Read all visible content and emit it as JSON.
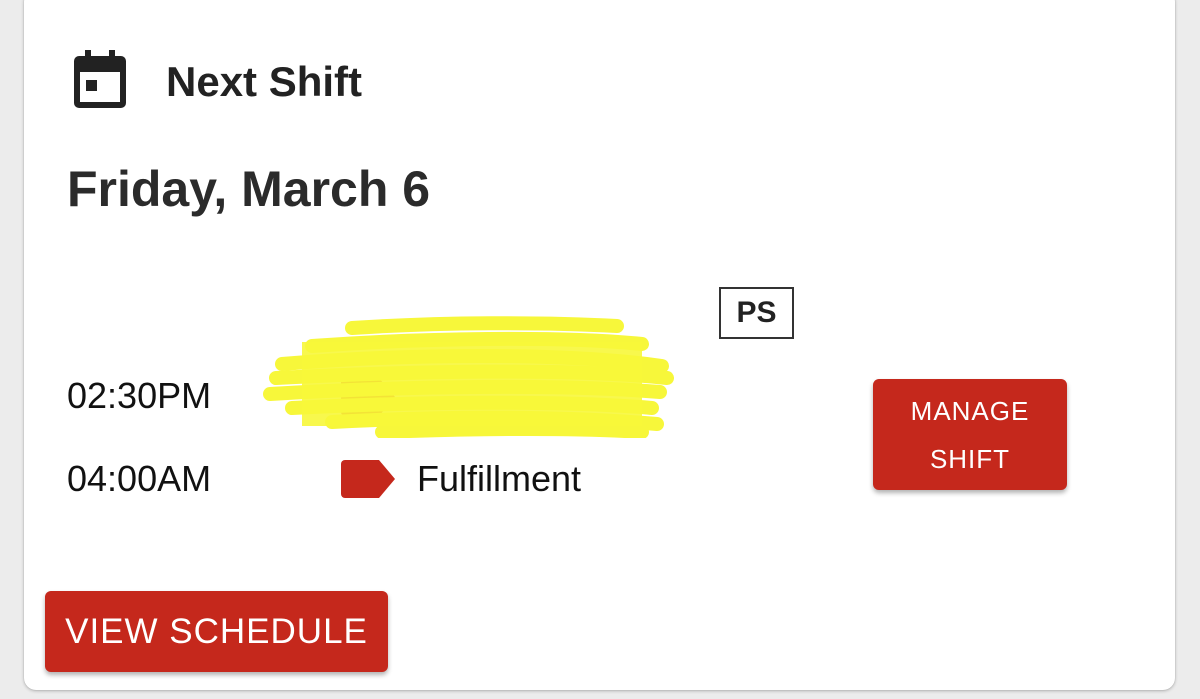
{
  "card": {
    "title": "Next Shift",
    "title_icon": "calendar-icon",
    "date": "Friday, March 6",
    "badge": "PS",
    "shift": {
      "start_time": "02:30PM",
      "end_time": "04:00AM",
      "department": "Fulfillment",
      "department_icon": "label-tag-icon",
      "department_color": "#c5281c"
    },
    "redaction_color": "#f7f73a",
    "manage_button": "MANAGE SHIFT",
    "view_button": "VIEW SCHEDULE"
  },
  "colors": {
    "accent": "#c5281c",
    "text": "#222222",
    "background": "#ffffff"
  }
}
